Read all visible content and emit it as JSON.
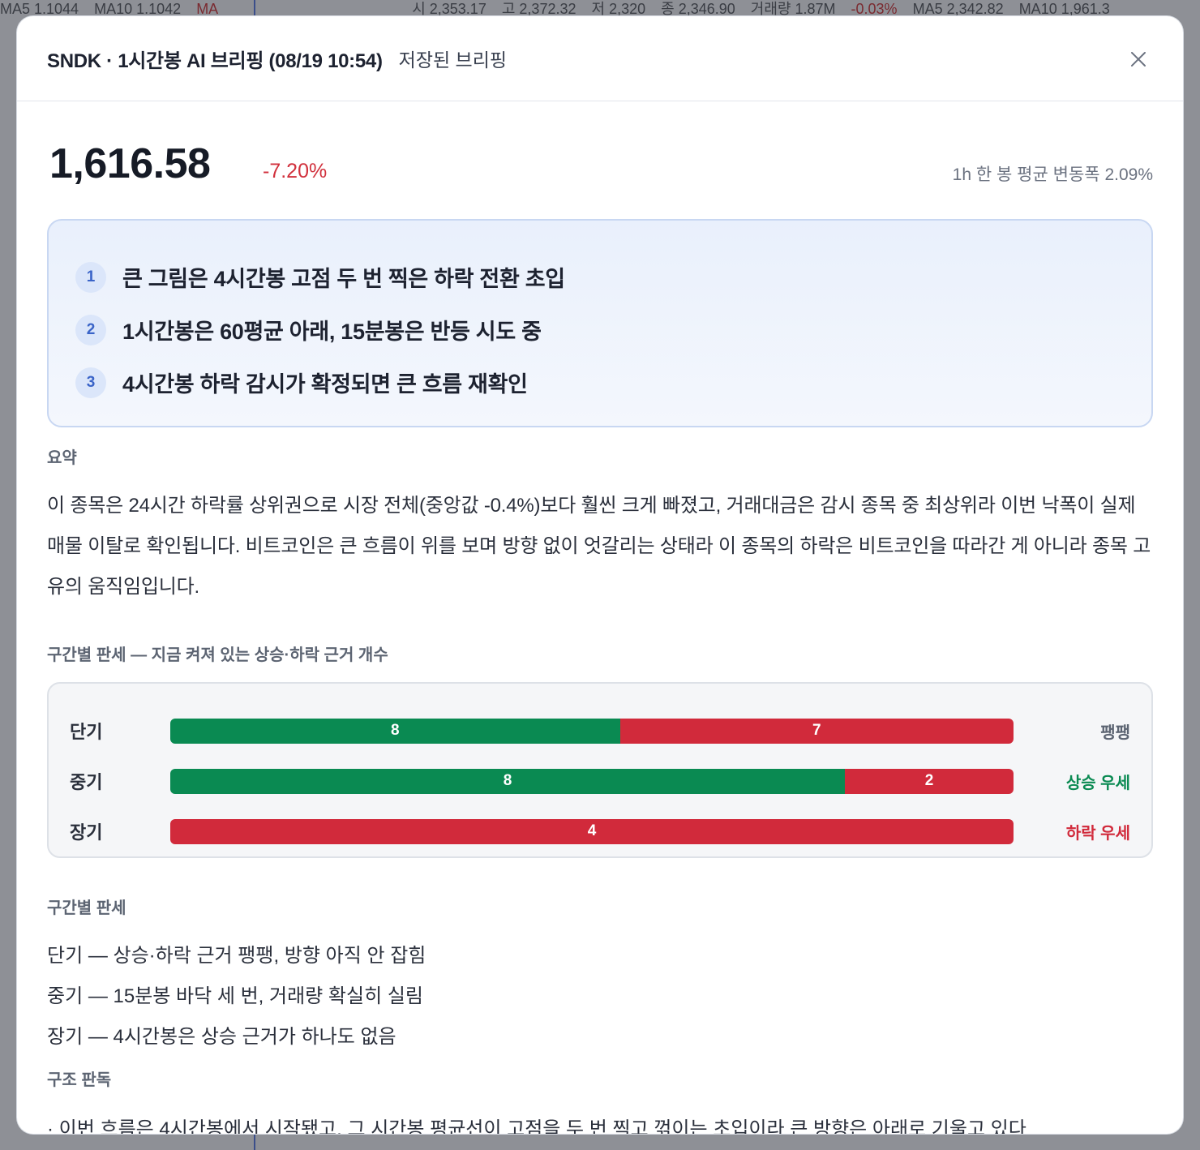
{
  "background": {
    "top_strip": [
      "MA5 1.1044",
      "MA10 1.1042",
      "MA",
      "시 2,353.17",
      "고 2,372.32",
      "저 2,320",
      "종 2,346.90",
      "거래량 1.87M",
      "-0.03%",
      "MA5 2,342.82",
      "MA10 1,961.3"
    ]
  },
  "modal": {
    "title": "SNDK · 1시간봉 AI 브리핑 (08/19 10:54)",
    "subtitle": "저장된 브리핑",
    "close_icon": "×"
  },
  "price": {
    "value": "1,616.58",
    "change": "-7.20%",
    "volatility": "1h 한 봉 평균 변동폭 2.09%"
  },
  "key_points": [
    {
      "num": "1",
      "text": "큰 그림은 4시간봉 고점 두 번 찍은 하락 전환 초입"
    },
    {
      "num": "2",
      "text": "1시간봉은 60평균 아래, 15분봉은 반등 시도 중"
    },
    {
      "num": "3",
      "text": "4시간봉 하락 감시가 확정되면 큰 흐름 재확인"
    }
  ],
  "summary": {
    "label": "요약",
    "text": "이 종목은 24시간 하락률 상위권으로 시장 전체(중앙값 -0.4%)보다 훨씬 크게 빠졌고, 거래대금은 감시 종목 중 최상위라 이번 낙폭이 실제 매물 이탈로 확인됩니다. 비트코인은 큰 흐름이 위를 보며 방향 없이 엇갈리는 상태라 이 종목의 하락은 비트코인을 따라간 게 아니라 종목 고유의 움직임입니다."
  },
  "verdict": {
    "label": "구간별 판세 — 지금 켜져 있는 상승·하락 근거 개수",
    "rows": [
      {
        "name": "단기",
        "up": 8,
        "down": 7,
        "verdict": "팽팽",
        "verdict_color": "#5c6472"
      },
      {
        "name": "중기",
        "up": 8,
        "down": 2,
        "verdict": "상승 우세",
        "verdict_color": "#0a8a52"
      },
      {
        "name": "장기",
        "up": 0,
        "down": 4,
        "verdict": "하락 우세",
        "verdict_color": "#d12a3b"
      }
    ],
    "colors": {
      "up": "#0a8a52",
      "down": "#d12a3b"
    }
  },
  "details": {
    "label": "구간별 판세",
    "lines": [
      "단기 — 상승·하락 근거 팽팽, 방향 아직 안 잡힘",
      "중기 — 15분봉 바닥 세 번, 거래량 확실히 실림",
      "장기 — 4시간봉은 상승 근거가 하나도 없음"
    ]
  },
  "structure": {
    "label": "구조 판독",
    "line": "· 이번 흐름은 4시간봉에서 시작됐고, 그 시간봉 평균선이 고점을 두 번 찍고 꺾이는 초입이라 큰 방향은 아래로 기울고 있다"
  }
}
